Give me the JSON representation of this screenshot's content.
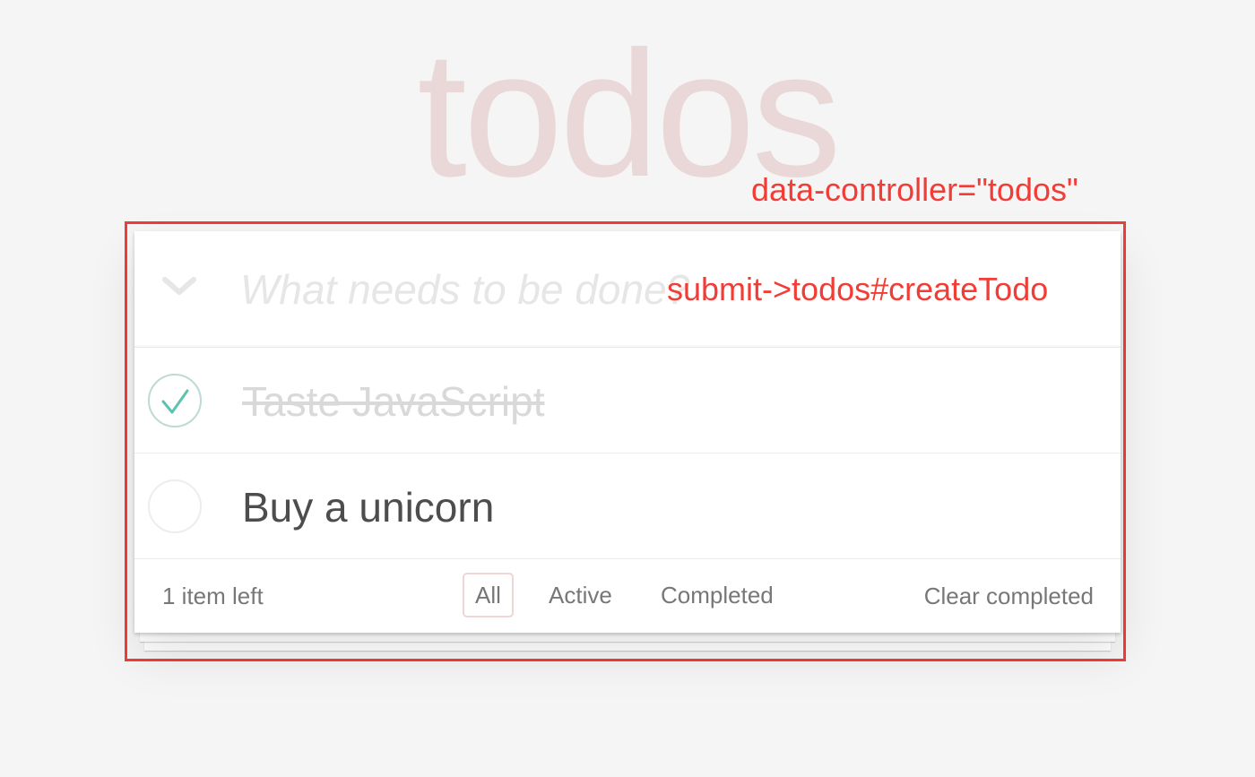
{
  "header": {
    "title": "todos",
    "controller_annotation": "data-controller=\"todos\""
  },
  "new_todo": {
    "placeholder": "What needs to be done?",
    "value": "",
    "action_annotation": "submit->todos#createTodo"
  },
  "todos": [
    {
      "title": "Taste JavaScript",
      "completed": true
    },
    {
      "title": "Buy a unicorn",
      "completed": false
    }
  ],
  "footer": {
    "items_left": "1 item left",
    "filters": [
      {
        "label": "All",
        "selected": true
      },
      {
        "label": "Active",
        "selected": false
      },
      {
        "label": "Completed",
        "selected": false
      }
    ],
    "clear_completed": "Clear completed"
  },
  "colors": {
    "title": "#eed8d8",
    "annotation": "#f23c36",
    "check": "#5dc2af",
    "background": "#f5f5f5"
  },
  "icons": {
    "toggle_all": "chevron-down-icon",
    "completed_check": "checkmark-icon",
    "empty_check": "empty-circle-icon"
  }
}
